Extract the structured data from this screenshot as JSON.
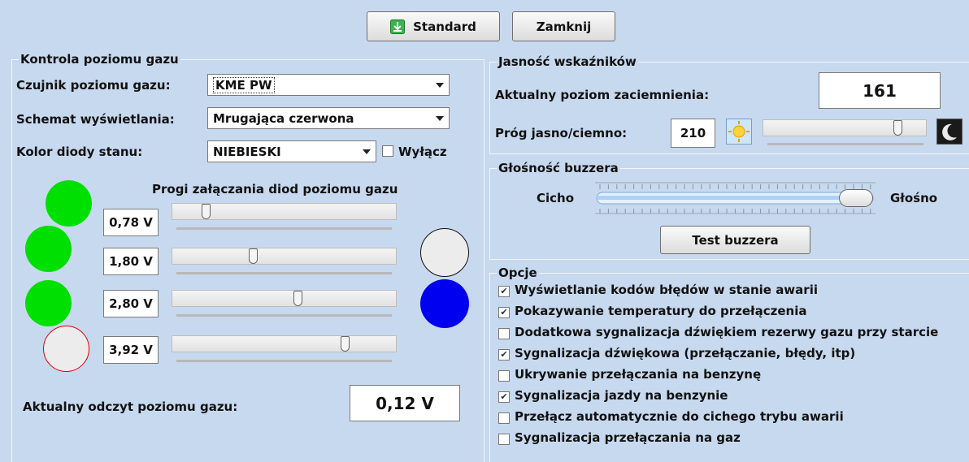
{
  "top_buttons": {
    "standard": "Standard",
    "close": "Zamknij"
  },
  "gas_level": {
    "title": "Kontrola poziomu gazu",
    "sensor_label": "Czujnik poziomu gazu:",
    "sensor_value": "KME PW",
    "scheme_label": "Schemat wyświetlania:",
    "scheme_value": "Mrugająca czerwona",
    "led_color_label": "Kolor diody stanu:",
    "led_color_value": "NIEBIESKI",
    "disable_label": "Wyłącz",
    "disable_checked": false,
    "thresholds_title": "Progi załączania diod poziomu gazu",
    "thresholds": [
      {
        "value": "0,78 V",
        "slider_fraction": 0.15
      },
      {
        "value": "1,80 V",
        "slider_fraction": 0.36
      },
      {
        "value": "2,80 V",
        "slider_fraction": 0.56
      },
      {
        "value": "3,92 V",
        "slider_fraction": 0.77
      }
    ],
    "led_states": [
      "green",
      "green",
      "green",
      "empty-red-outline"
    ],
    "reading_label": "Aktualny odczyt poziomu gazu:",
    "reading_value": "0,12 V"
  },
  "brightness": {
    "title": "Jasność wskaźników",
    "level_label": "Aktualny poziom zaciemnienia:",
    "level_value": "161",
    "threshold_label": "Próg jasno/ciemno:",
    "threshold_value": "210",
    "slider_fraction": 0.82
  },
  "buzzer": {
    "title": "Głośność buzzera",
    "quiet_label": "Cicho",
    "loud_label": "Głośno",
    "volume_fraction": 1.0,
    "test_button": "Test buzzera"
  },
  "options": {
    "title": "Opcje",
    "items": [
      {
        "label": "Wyświetlanie kodów błędów w stanie awarii",
        "checked": true
      },
      {
        "label": "Pokazywanie temperatury do przełączenia",
        "checked": true
      },
      {
        "label": "Dodatkowa sygnalizacja dźwiękiem rezerwy gazu przy starcie",
        "checked": false
      },
      {
        "label": "Sygnalizacja dźwiękowa (przełączanie, błędy, itp)",
        "checked": true
      },
      {
        "label": "Ukrywanie przełączania na benzynę",
        "checked": false
      },
      {
        "label": "Sygnalizacja jazdy na benzynie",
        "checked": true
      },
      {
        "label": "Przełącz automatycznie do cichego trybu awarii",
        "checked": false
      },
      {
        "label": "Sygnalizacja przełączania na gaz",
        "checked": false
      }
    ]
  },
  "colors": {
    "led_green": "#00e000",
    "led_blue": "#0000f0",
    "led_off": "#ececec",
    "panel_bg": "#c7d9ee"
  }
}
